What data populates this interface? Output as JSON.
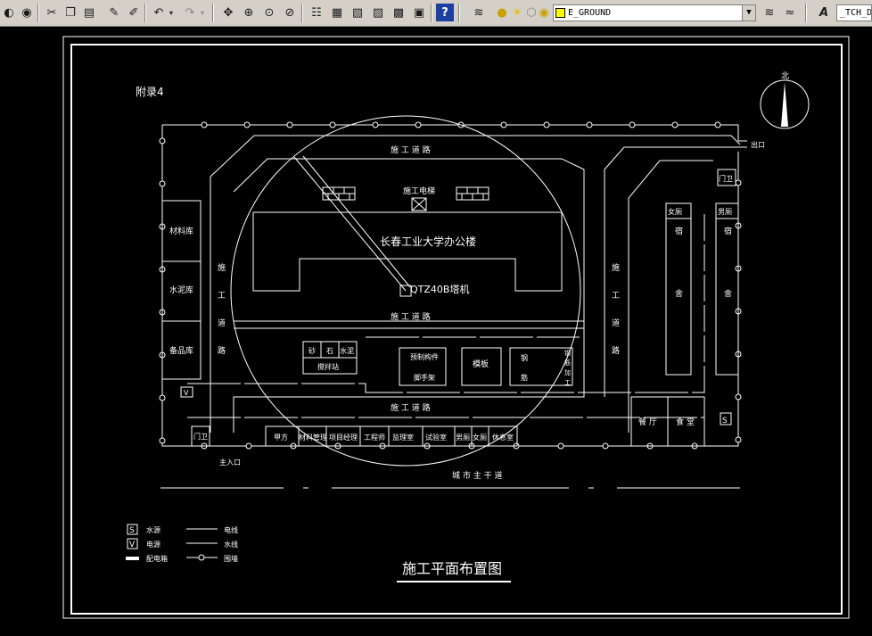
{
  "toolbar": {
    "layer_name": "E_GROUND",
    "text_style": "_TCH_D"
  },
  "drawing": {
    "appendix_label": "附录4",
    "north_label": "北",
    "exit_label": "出口",
    "road_label": "施 工 道 路",
    "road_vertical": [
      "施",
      "工",
      "道",
      "路"
    ],
    "tower_crane_top": "施工电梯",
    "office_building": "长春工业大学办公楼",
    "tower_crane": "QTZ40B塔机",
    "warehouses": [
      "材料库",
      "水泥库",
      "备品库"
    ],
    "sand_stone_cement": [
      "砂",
      "石",
      "水泥"
    ],
    "mixing_station": "搅拌站",
    "prefab": [
      "预制构件",
      "脚手架"
    ],
    "formwork": "模板",
    "steel_bar": [
      "钢",
      "筋"
    ],
    "steel_processing": [
      "钢",
      "筋",
      "加",
      "工"
    ],
    "gate_guard": "门卫",
    "gate_guard_right": "门卫",
    "main_entrance": "主入口",
    "bottom_rooms": [
      "甲方",
      "材料管理",
      "项目经理",
      "工程师",
      "监理室",
      "试验室",
      "男厕",
      "女厕",
      "休息室"
    ],
    "womens_toilet": "女厕",
    "mens_toilet": "男厕",
    "dormitory_a": [
      "宿",
      "舍"
    ],
    "dormitory_b": [
      "宿",
      "舍"
    ],
    "dining": [
      "餐 厅",
      "食 堂"
    ],
    "city_road": "城 市 主 干 道",
    "water_symbol": "S",
    "power_symbol": "V",
    "legend": {
      "items_left": [
        "水源",
        "电源",
        "配电箱"
      ],
      "items_right": [
        "电线",
        "水线",
        "围墙"
      ]
    },
    "title": "施工平面布置图"
  }
}
